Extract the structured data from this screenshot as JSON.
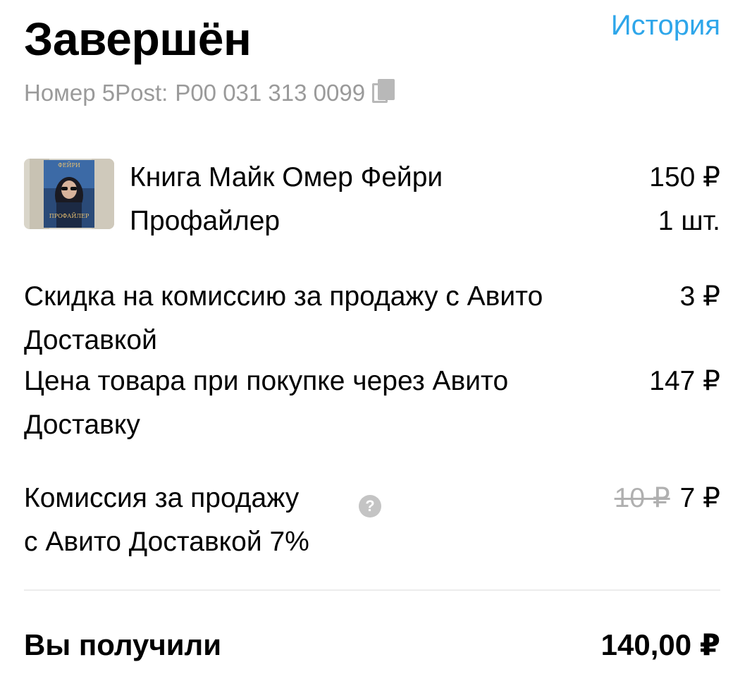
{
  "header": {
    "status_title": "Завершён",
    "history_link": "История"
  },
  "tracking": {
    "label": "Номер 5Post:",
    "number": "P00 031 313 0099"
  },
  "product": {
    "name_line1": "Книга Майк Омер Фейри",
    "name_line2": "Профайлер",
    "price": "150 ₽",
    "quantity": "1 шт.",
    "cover_text_top": "ФЕЙРИ",
    "cover_text_bottom": "ПРОФАЙЛЕР"
  },
  "lines": {
    "discount": {
      "label": "Скидка на комиссию за продажу с Авито Доставкой",
      "value": "3 ₽"
    },
    "item_price": {
      "label": "Цена товара при покупке через Авито Доставку",
      "value": "147 ₽"
    },
    "commission": {
      "label_line1": "Комиссия за продажу",
      "label_line2": "с Авито Доставкой 7%",
      "old_value": "10 ₽",
      "value": "7 ₽",
      "help_icon": "?"
    }
  },
  "total": {
    "label": "Вы получили",
    "value": "140,00 ₽"
  },
  "colors": {
    "accent": "#2ea6ea",
    "muted": "#9a9a9a",
    "divider": "#ececec"
  },
  "icons": {
    "copy": "copy-icon",
    "help": "question-circle-icon",
    "thumbnail": "book-cover-thumbnail"
  }
}
